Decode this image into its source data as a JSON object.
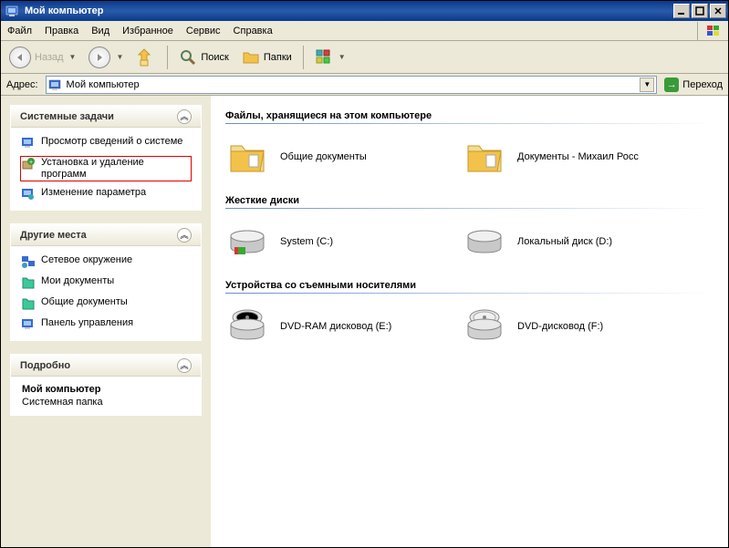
{
  "window": {
    "title": "Мой компьютер"
  },
  "menu": {
    "file": "Файл",
    "edit": "Правка",
    "view": "Вид",
    "favorites": "Избранное",
    "tools": "Сервис",
    "help": "Справка"
  },
  "toolbar": {
    "back": "Назад",
    "search": "Поиск",
    "folders": "Папки"
  },
  "address": {
    "label": "Адрес:",
    "value": "Мой компьютер",
    "go": "Переход"
  },
  "sidebar": {
    "system_tasks": {
      "title": "Системные задачи",
      "items": [
        "Просмотр сведений о системе",
        "Установка и удаление программ",
        "Изменение параметра"
      ]
    },
    "other_places": {
      "title": "Другие места",
      "items": [
        "Сетевое окружение",
        "Мои документы",
        "Общие документы",
        "Панель управления"
      ]
    },
    "details": {
      "title": "Подробно",
      "name": "Мой компьютер",
      "type": "Системная папка"
    }
  },
  "content": {
    "group1": {
      "title": "Файлы, хранящиеся на этом компьютере",
      "items": [
        "Общие документы",
        "Документы - Михаил Росс"
      ]
    },
    "group2": {
      "title": "Жесткие диски",
      "items": [
        "System (C:)",
        "Локальный диск (D:)"
      ]
    },
    "group3": {
      "title": "Устройства со съемными носителями",
      "items": [
        "DVD-RAM дисковод (E:)",
        "DVD-дисковод (F:)"
      ]
    }
  }
}
